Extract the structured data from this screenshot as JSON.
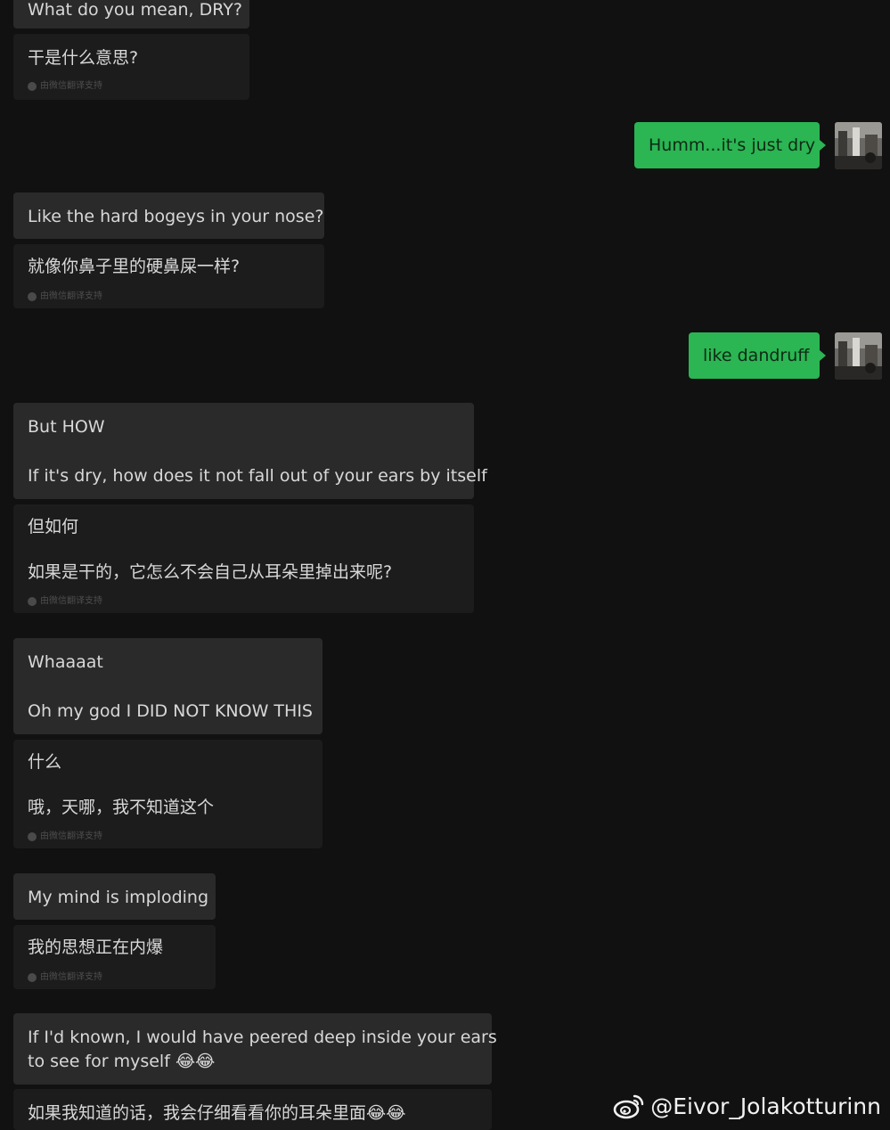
{
  "chat": {
    "m1": {
      "text": "What do you mean, DRY?",
      "translation": "干是什么意思?",
      "note": "由微信翻译支持"
    },
    "s1": {
      "text": "Humm...it's just dry"
    },
    "m2": {
      "text": "Like the hard bogeys in your nose?",
      "translation": "就像你鼻子里的硬鼻屎一样?",
      "note": "由微信翻译支持"
    },
    "s2": {
      "text": "like dandruff"
    },
    "m3": {
      "line1": "But HOW",
      "line2": "If it's dry, how does it not fall out of your ears by itself",
      "tline1": "但如何",
      "tline2": "如果是干的，它怎么不会自己从耳朵里掉出来呢?",
      "note": "由微信翻译支持"
    },
    "m4": {
      "line1": "Whaaaat",
      "line2": "Oh my god I DID NOT KNOW THIS",
      "tline1": "什么",
      "tline2": "哦，天哪，我不知道这个",
      "note": "由微信翻译支持"
    },
    "m5": {
      "text": "My mind is imploding",
      "translation": "我的思想正在内爆",
      "note": "由微信翻译支持"
    },
    "m6": {
      "line1": "If I'd known, I would have peered deep inside your ears",
      "line2": "to see for myself 😂😂",
      "translation": "如果我知道的话，我会仔细看看你的耳朵里面😂😂"
    }
  },
  "watermark": {
    "handle": "@Eivor_Jolakotturinn"
  },
  "colors": {
    "background": "#111111",
    "received_bubble": "#2a2a2a",
    "translation_bubble": "#1c1c1c",
    "sent_bubble": "#2bb553"
  },
  "icons": {
    "translate_note": "translate-icon",
    "watermark": "weibo-icon"
  }
}
